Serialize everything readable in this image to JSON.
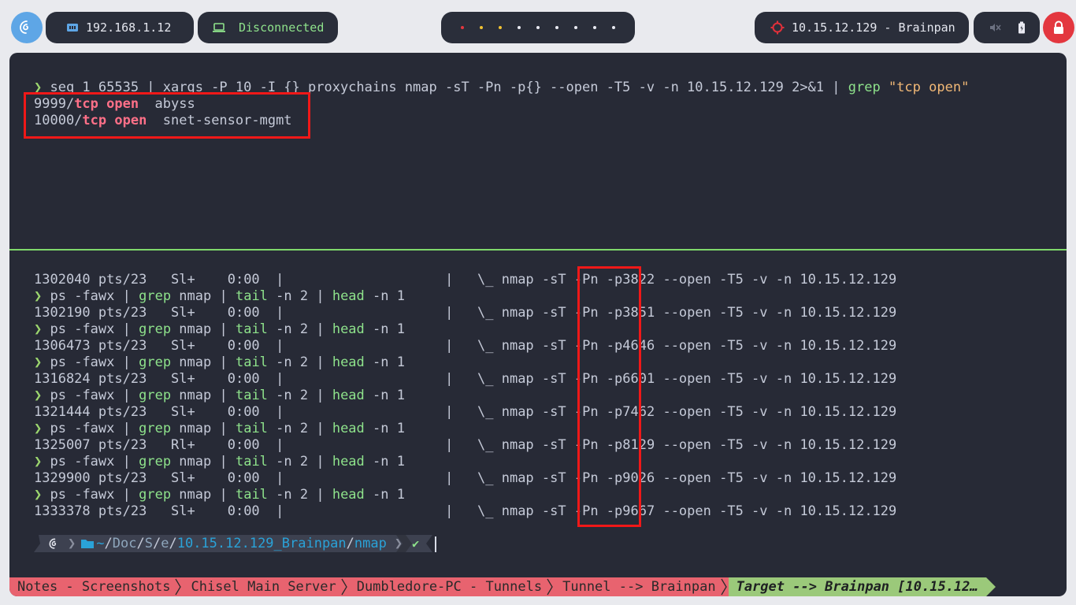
{
  "topbar": {
    "ip_address": "192.168.1.12",
    "vpn_status": "Disconnected",
    "workspace_count": 9,
    "target": "10.15.12.129 - Brainpan",
    "colors": {
      "pill_bg": "#2a2e3a",
      "vpn_green": "#8ee28b",
      "target_red": "#e0303a",
      "lock_red": "#e3373f"
    }
  },
  "pane_top": {
    "command": {
      "prompt": "❯",
      "part1": " seq 1 65535 | xargs -P 10 -I {} proxychains nmap -sT -Pn -p{} --open -T5 -v -n 10.15.12.129 2>&1 | ",
      "grep": "grep",
      "space": " ",
      "quoted": "\"tcp open\""
    },
    "results": [
      {
        "port": "9999/",
        "proto": "tcp open",
        "service": "  abyss"
      },
      {
        "port": "10000/",
        "proto": "tcp open",
        "service": "  snet-sensor-mgmt"
      }
    ]
  },
  "pane_bottom": {
    "processes": [
      {
        "pid": "1302040",
        "tty": "pts/23",
        "stat": "Sl+",
        "time": "0:00",
        "tree": "|                    |   \\_ nmap -sT -Pn ",
        "port_flag": "-p3822",
        "rest": " --open -T5 -v -n 10.15.12.129"
      },
      {
        "pid": "1302190",
        "tty": "pts/23",
        "stat": "Sl+",
        "time": "0:00",
        "tree": "|                    |   \\_ nmap -sT -Pn ",
        "port_flag": "-p3851",
        "rest": " --open -T5 -v -n 10.15.12.129"
      },
      {
        "pid": "1306473",
        "tty": "pts/23",
        "stat": "Sl+",
        "time": "0:00",
        "tree": "|                    |   \\_ nmap -sT -Pn ",
        "port_flag": "-p4646",
        "rest": " --open -T5 -v -n 10.15.12.129"
      },
      {
        "pid": "1316824",
        "tty": "pts/23",
        "stat": "Sl+",
        "time": "0:00",
        "tree": "|                    |   \\_ nmap -sT -Pn ",
        "port_flag": "-p6601",
        "rest": " --open -T5 -v -n 10.15.12.129"
      },
      {
        "pid": "1321444",
        "tty": "pts/23",
        "stat": "Sl+",
        "time": "0:00",
        "tree": "|                    |   \\_ nmap -sT -Pn ",
        "port_flag": "-p7462",
        "rest": " --open -T5 -v -n 10.15.12.129"
      },
      {
        "pid": "1325007",
        "tty": "pts/23",
        "stat": "Rl+",
        "time": "0:00",
        "tree": "|                    |   \\_ nmap -sT -Pn ",
        "port_flag": "-p8129",
        "rest": " --open -T5 -v -n 10.15.12.129"
      },
      {
        "pid": "1329900",
        "tty": "pts/23",
        "stat": "Sl+",
        "time": "0:00",
        "tree": "|                    |   \\_ nmap -sT -Pn ",
        "port_flag": "-p9026",
        "rest": " --open -T5 -v -n 10.15.12.129"
      },
      {
        "pid": "1333378",
        "tty": "pts/23",
        "stat": "Sl+",
        "time": "0:00",
        "tree": "|                    |   \\_ nmap -sT -Pn ",
        "port_flag": "-p9667",
        "rest": " --open -T5 -v -n 10.15.12.129"
      }
    ],
    "watch_cmd": {
      "prompt": "❯",
      "ps": " ps ",
      "ps_flags": "-fawx",
      "pipe1": " | ",
      "grep": "grep",
      "grep_arg": " nmap",
      "pipe2": " | ",
      "tail": "tail",
      "tail_args": " -n 2",
      "pipe3": " | ",
      "head": "head",
      "head_args": " -n 1"
    },
    "prompt_path": {
      "home": "~",
      "seg1": "Doc",
      "seg2": "S",
      "seg3": "e",
      "seg4": "10.15.12.129_Brainpan",
      "seg5": "nmap",
      "sep": "/",
      "check": "✔"
    }
  },
  "statusbar": {
    "tabs": [
      "Notes - Screenshots",
      "Chisel Main Server",
      "Dumbledore-PC - Tunnels",
      "Tunnel --> Brainpan"
    ],
    "active_tab": "Target --> Brainpan [10.15.12…"
  }
}
